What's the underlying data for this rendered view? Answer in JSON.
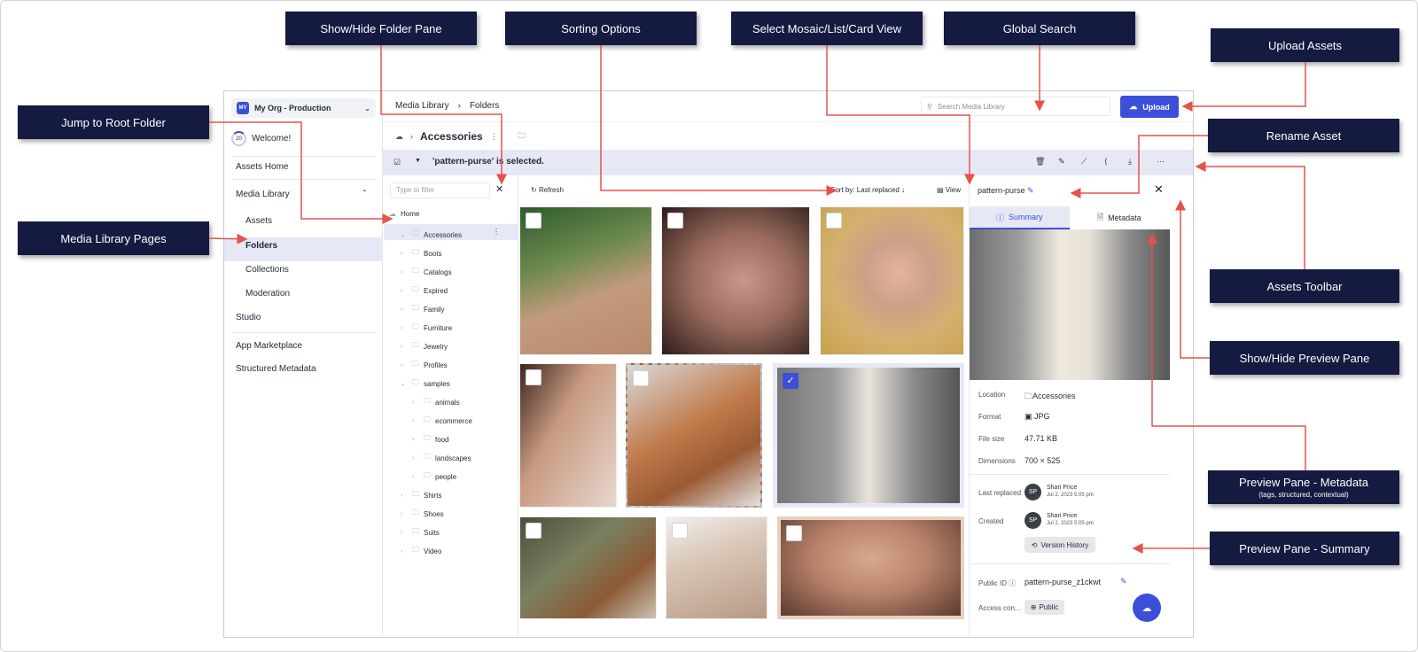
{
  "callouts": {
    "folder_pane": "Show/Hide Folder Pane",
    "sorting": "Sorting Options",
    "view_mode": "Select Mosaic/List/Card View",
    "global_search": "Global Search",
    "upload_assets": "Upload Assets",
    "root_folder": "Jump to Root Folder",
    "rename_asset": "Rename Asset",
    "library_pages": "Media Library Pages",
    "assets_toolbar": "Assets Toolbar",
    "preview_pane": "Show/Hide Preview Pane",
    "preview_metadata": "Preview Pane - Metadata",
    "preview_metadata_sub": "(tags, structured, contextual)",
    "preview_summary": "Preview Pane - Summary"
  },
  "nav": {
    "org_badge": "MY",
    "org_name": "My Org - Production",
    "welcome_count": "20",
    "welcome": "Welcome!",
    "assets_home": "Assets Home",
    "media_library": "Media Library",
    "assets": "Assets",
    "folders": "Folders",
    "collections": "Collections",
    "moderation": "Moderation",
    "studio": "Studio",
    "app_marketplace": "App Marketplace",
    "structured_metadata": "Structured Metadata"
  },
  "header": {
    "crumb_1": "Media Library",
    "crumb_2": "Folders",
    "search_placeholder": "Search Media Library",
    "upload": "Upload",
    "folder_title": "Accessories"
  },
  "selection": {
    "text": "'pattern-purse' is selected."
  },
  "tree": {
    "filter_placeholder": "Type to filter",
    "home": "Home",
    "items": [
      "Accessories",
      "Boots",
      "Catalogs",
      "Expired",
      "Family",
      "Furniture",
      "Jewelry",
      "Profiles",
      "samples",
      "animals",
      "ecommerce",
      "food",
      "landscapes",
      "people",
      "Shirts",
      "Shoes",
      "Suits",
      "Video"
    ]
  },
  "content": {
    "refresh": "Refresh",
    "sort": "Sort by: Last replaced",
    "view": "View"
  },
  "preview": {
    "name": "pattern-purse",
    "tab_summary": "Summary",
    "tab_metadata": "Metadata",
    "location_label": "Location",
    "location": "Accessories",
    "format_label": "Format",
    "format": "JPG",
    "size_label": "File size",
    "size": "47.71 KB",
    "dim_label": "Dimensions",
    "dim": "700 × 525",
    "replaced_label": "Last replaced",
    "created_label": "Created",
    "initials": "SP",
    "user": "Shari Price",
    "date": "Jul 2, 2023 5:05 pm",
    "version_history": "Version History",
    "public_id_label": "Public ID",
    "public_id": "pattern-purse_z1ckwt",
    "access_label": "Access con...",
    "access": "Public"
  }
}
